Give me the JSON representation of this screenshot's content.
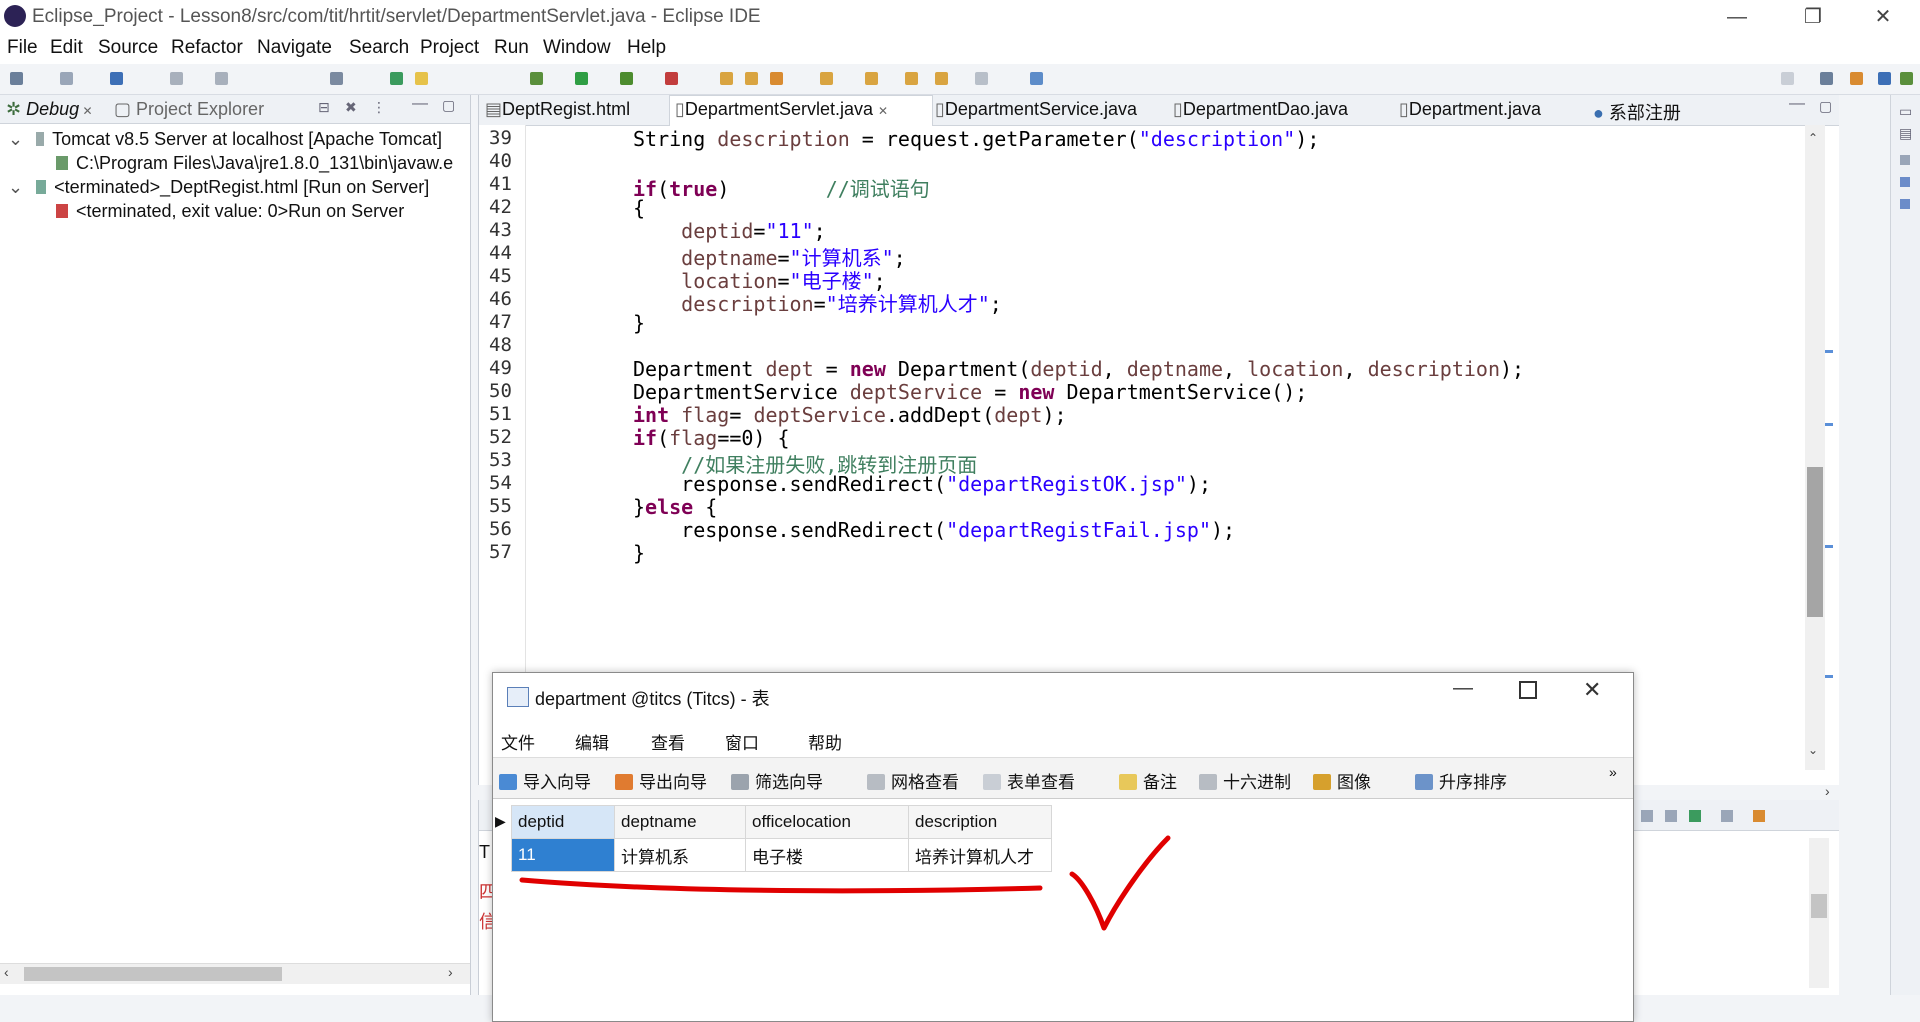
{
  "window": {
    "title": "Eclipse_Project - Lesson8/src/com/tit/hrtit/servlet/DepartmentServlet.java - Eclipse IDE",
    "min": "—",
    "restore": "❐",
    "close": "✕"
  },
  "menu": [
    "File",
    "Edit",
    "Source",
    "Refactor",
    "Navigate",
    "Search",
    "Project",
    "Run",
    "Window",
    "Help"
  ],
  "debug_panel": {
    "tabs": [
      {
        "label": "Debug",
        "active": true
      },
      {
        "label": "Project Explorer",
        "active": false
      }
    ],
    "tree": [
      {
        "text": "Tomcat v8.5 Server at localhost [Apache Tomcat]",
        "level": 0,
        "expanded": true
      },
      {
        "text": "C:\\Program Files\\Java\\jre1.8.0_131\\bin\\javaw.e",
        "level": 1
      },
      {
        "text": "<terminated>_DeptRegist.html [Run on Server]",
        "level": 0,
        "expanded": true
      },
      {
        "text": "<terminated, exit value: 0>Run on Server",
        "level": 1
      }
    ]
  },
  "editor": {
    "tabs": [
      {
        "label": "DeptRegist.html",
        "active": false
      },
      {
        "label": "DepartmentServlet.java",
        "active": true
      },
      {
        "label": "DepartmentService.java",
        "active": false
      },
      {
        "label": "DepartmentDao.java",
        "active": false
      },
      {
        "label": "Department.java",
        "active": false
      },
      {
        "label": "系部注册",
        "active": false
      }
    ],
    "lines": [
      {
        "n": "39",
        "code": "String description = request.getParameter(\"description\");"
      },
      {
        "n": "40",
        "code": ""
      },
      {
        "n": "41",
        "code": "if(true)        //调试语句"
      },
      {
        "n": "42",
        "code": "{"
      },
      {
        "n": "43",
        "code": "    deptid=\"11\";"
      },
      {
        "n": "44",
        "code": "    deptname=\"计算机系\";"
      },
      {
        "n": "45",
        "code": "    location=\"电子楼\";"
      },
      {
        "n": "46",
        "code": "    description=\"培养计算机人才\";"
      },
      {
        "n": "47",
        "code": "}"
      },
      {
        "n": "48",
        "code": ""
      },
      {
        "n": "49",
        "code": "Department dept = new Department(deptid, deptname, location, description);"
      },
      {
        "n": "50",
        "code": "DepartmentService deptService = new DepartmentService();"
      },
      {
        "n": "51",
        "code": "int flag= deptService.addDept(dept);"
      },
      {
        "n": "52",
        "code": "if(flag==0) {"
      },
      {
        "n": "53",
        "code": "    //如果注册失败,跳转到注册页面"
      },
      {
        "n": "54",
        "code": "    response.sendRedirect(\"departRegistOK.jsp\");"
      },
      {
        "n": "55",
        "code": "}else {"
      },
      {
        "n": "56",
        "code": "    response.sendRedirect(\"departRegistFail.jsp\");"
      },
      {
        "n": "57",
        "code": "}"
      }
    ]
  },
  "console": {
    "label_partial": "T",
    "glyphs": [
      "四",
      "信"
    ]
  },
  "navicat": {
    "title": "department @titcs (Titcs) - 表",
    "menu": [
      "文件",
      "编辑",
      "查看",
      "窗口",
      "帮助"
    ],
    "toolbar": [
      "导入向导",
      "导出向导",
      "筛选向导",
      "网格查看",
      "表单查看",
      "备注",
      "十六进制",
      "图像",
      "升序排序"
    ],
    "columns": [
      "deptid",
      "deptname",
      "officelocation",
      "description"
    ],
    "rows": [
      [
        "11",
        "计算机系",
        "电子楼",
        "培养计算机人才"
      ]
    ]
  },
  "colors": {
    "keyword": "#7f0055",
    "string": "#2a00ff",
    "comment": "#3f7f5f",
    "annotation": "#e00000"
  }
}
